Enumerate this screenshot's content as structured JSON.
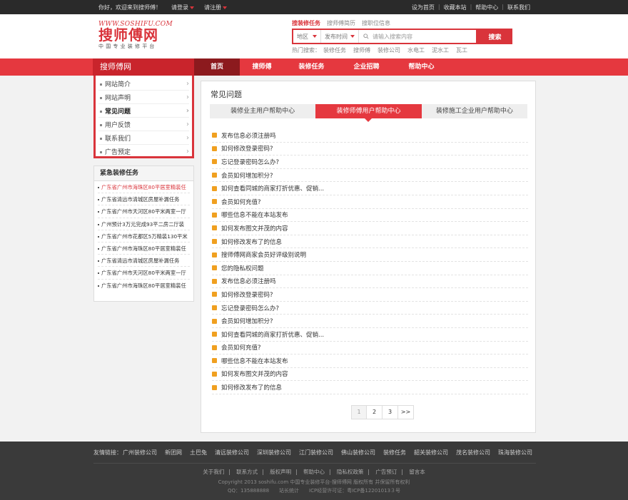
{
  "topbar": {
    "welcome": "你好，欢迎来到搜师傅！",
    "login": "请登录",
    "register": "请注册",
    "right_links": [
      "设为首页",
      "收藏本站",
      "帮助中心",
      "联系我们"
    ]
  },
  "logo": {
    "url": "WWW.SOSHIFU.COM",
    "name": "搜师傅网",
    "slogan": "中国专业装修平台"
  },
  "search": {
    "tabs": [
      "搜装修任务",
      "搜师傅简历",
      "搜职位信息"
    ],
    "region": "地区",
    "time": "发布时间",
    "placeholder": "请输入搜索内容",
    "button": "搜索",
    "hot_label": "热门搜索：",
    "hot": [
      "装修任务",
      "搜师傅",
      "装修公司",
      "水电工",
      "泥水工",
      "瓦工"
    ]
  },
  "nav": {
    "brand": "搜师傅网",
    "items": [
      "首页",
      "搜师傅",
      "装修任务",
      "企业招聘",
      "帮助中心"
    ]
  },
  "side_menu": [
    "网站简介",
    "网站声明",
    "常见问题",
    "用户反馈",
    "联系我们",
    "广告预定"
  ],
  "urgent": {
    "title": "紧急装修任务",
    "items": [
      "广东省广州市海珠区80平居室精装任",
      "广东省清远市清城区房屋补漏任务",
      "广东省广州市天河区80平米两室一厅",
      "广州预计3万元完成93平二房二厅装",
      "广东省广州市花都区5万精装130平米",
      "广东省广州市海珠区80平居室精装任",
      "广东省清远市清城区房屋补漏任务",
      "广东省广州市天河区80平米两室一厅",
      "广东省广州市海珠区80平居室精装任"
    ]
  },
  "main": {
    "title": "常见问题",
    "tabs": [
      "装修业主用户帮助中心",
      "装修师傅用户帮助中心",
      "装修施工企业用户帮助中心"
    ],
    "faq": [
      "发布信息必须注册吗",
      "如何修改登录密码?",
      "忘记登录密码怎么办?",
      "会员如何增加积分?",
      "如何查看同城的商家打折优惠、促销...",
      "会员如何充值?",
      "哪些信息不能在本站发布",
      "如何发布图文并茂的内容",
      "如何修改发布了的信息",
      "搜师傅网商家会员好评级别说明",
      "您的隐私权问题",
      "发布信息必须注册吗",
      "如何修改登录密码?",
      "忘记登录密码怎么办?",
      "会员如何增加积分?",
      "如何查看同城的商家打折优惠、促销...",
      "会员如何充值?",
      "哪些信息不能在本站发布",
      "如何发布图文并茂的内容",
      "如何修改发布了的信息"
    ],
    "pager": [
      "1",
      "2",
      "3",
      ">>"
    ]
  },
  "footer": {
    "friends_label": "友情链接：",
    "friends": [
      "广州装修公司",
      "新团网",
      "土巴兔",
      "清远装修公司",
      "深圳装修公司",
      "江门装修公司",
      "佛山装修公司",
      "装修任务",
      "韶关装修公司",
      "茂名装修公司",
      "珠海装修公司"
    ],
    "links": [
      "关于我们",
      "|",
      "联系方式",
      "|",
      "版权声明",
      "|",
      "帮助中心",
      "|",
      "隐私权政策",
      "|",
      "广告预订",
      "|",
      "留言本"
    ],
    "copyright": "Copyright 2013 soshifu.com  中国专业装修平台-搜师傅网 版权所有 并保留所有权利",
    "contact": "QQ：135888888　　站长统计　　ICP经营许可证：粤ICP备12201013３号"
  },
  "colors": {
    "accent": "#e5383f",
    "dark_accent": "#8c1a1e",
    "topbar": "#2a2a2a",
    "footer": "#3a3a3a"
  }
}
